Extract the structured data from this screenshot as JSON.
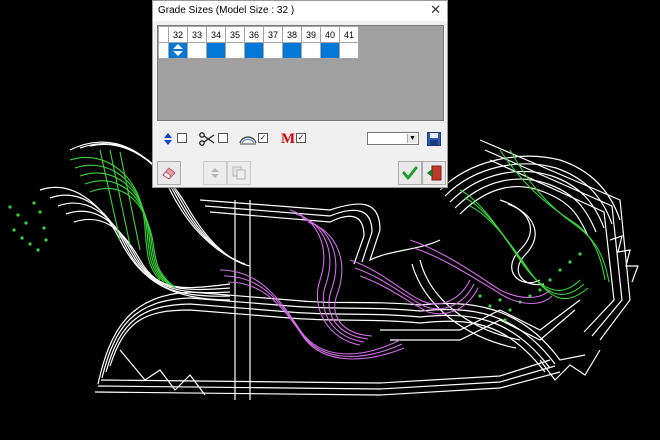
{
  "dialog": {
    "title": "Grade Sizes (Model Size : 32 )",
    "close_glyph": "✕",
    "sizes": [
      "32",
      "33",
      "34",
      "35",
      "36",
      "37",
      "38",
      "39",
      "40",
      "41"
    ],
    "model_size": "32",
    "selected_sizes": [
      "32",
      "34",
      "36",
      "38",
      "40"
    ],
    "toolbar": {
      "updown_icon": "up-down-arrows-icon",
      "updown_checked": false,
      "scissors_icon": "scissors-icon",
      "scissors_checked": false,
      "outline_icon": "outline-shape-icon",
      "outline_checked": true,
      "m_icon_label": "M",
      "m_checked": true,
      "combo_value": "",
      "save_icon": "floppy-disk-icon"
    },
    "buttons": {
      "eraser": "eraser-icon",
      "updown_small": "up-down-small-icon",
      "copy": "copy-icon",
      "ok": "checkmark-icon",
      "exit": "exit-door-icon"
    },
    "colors": {
      "check_green": "#1e9e2a",
      "selected_blue": "#0078d7",
      "m_red": "#d00000"
    }
  },
  "canvas": {
    "background": "#000000",
    "pattern_colors": [
      "#ffffff",
      "#39d43a",
      "#d26ee6"
    ]
  }
}
